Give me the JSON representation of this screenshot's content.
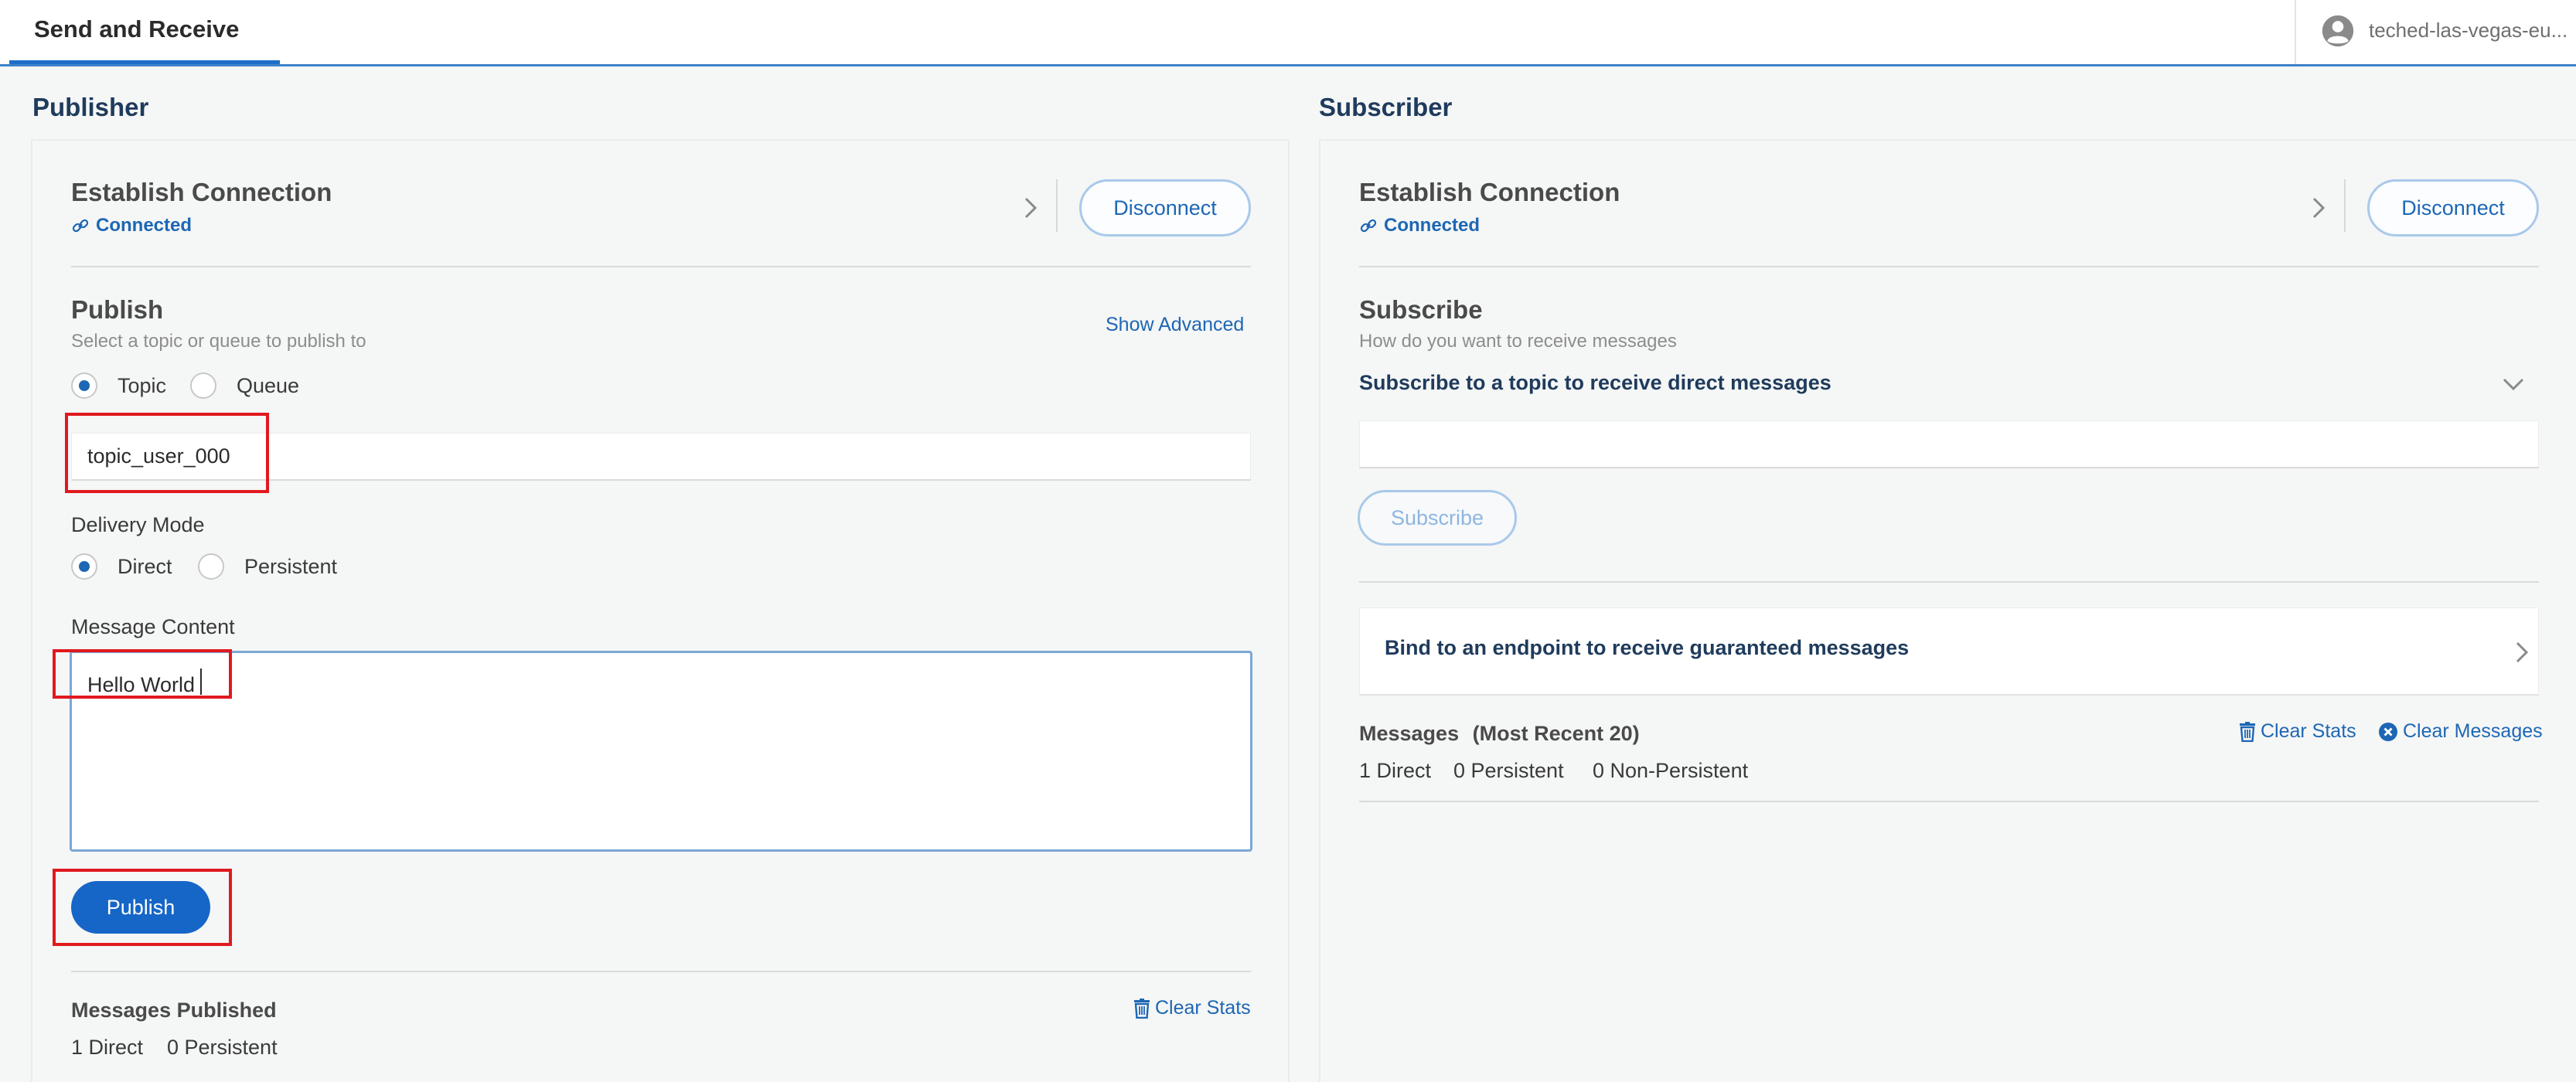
{
  "topbar": {
    "tab_label": "Send and Receive",
    "user_label": "teched-las-vegas-eu...",
    "user_icon": "user-circle-icon",
    "accent": "#1d6ec8"
  },
  "publisher": {
    "title": "Publisher",
    "connection": {
      "title": "Establish Connection",
      "status": "Connected",
      "status_icon": "link-icon",
      "disconnect_label": "Disconnect"
    },
    "publish": {
      "title": "Publish",
      "hint": "Select a topic or queue to publish to",
      "show_advanced": "Show Advanced",
      "dest_options": [
        "Topic",
        "Queue"
      ],
      "dest_selected": "Topic",
      "topic_value": "topic_user_000",
      "delivery_label": "Delivery Mode",
      "delivery_options": [
        "Direct",
        "Persistent"
      ],
      "delivery_selected": "Direct",
      "content_label": "Message Content",
      "content_value": "Hello World",
      "publish_label": "Publish"
    },
    "stats": {
      "title": "Messages Published",
      "clear_stats": "Clear Stats",
      "direct": "1 Direct",
      "persistent": "0 Persistent"
    }
  },
  "subscriber": {
    "title": "Subscriber",
    "connection": {
      "title": "Establish Connection",
      "status": "Connected",
      "status_icon": "link-icon",
      "disconnect_label": "Disconnect"
    },
    "subscribe": {
      "title": "Subscribe",
      "hint": "How do you want to receive messages",
      "direct_title": "Subscribe to a topic to receive direct messages",
      "topic_value": "",
      "subscribe_label": "Subscribe",
      "bind_label": "Bind to an endpoint to receive guaranteed messages"
    },
    "messages": {
      "title": "Messages",
      "subtitle": "(Most Recent 20)",
      "clear_stats": "Clear Stats",
      "clear_messages": "Clear Messages",
      "direct": "1 Direct",
      "persistent": "0 Persistent",
      "non_persistent": "0 Non-Persistent"
    }
  },
  "colors": {
    "primary": "#1566c7",
    "highlight_box": "#e0191f",
    "heading": "#1f3b5c"
  }
}
